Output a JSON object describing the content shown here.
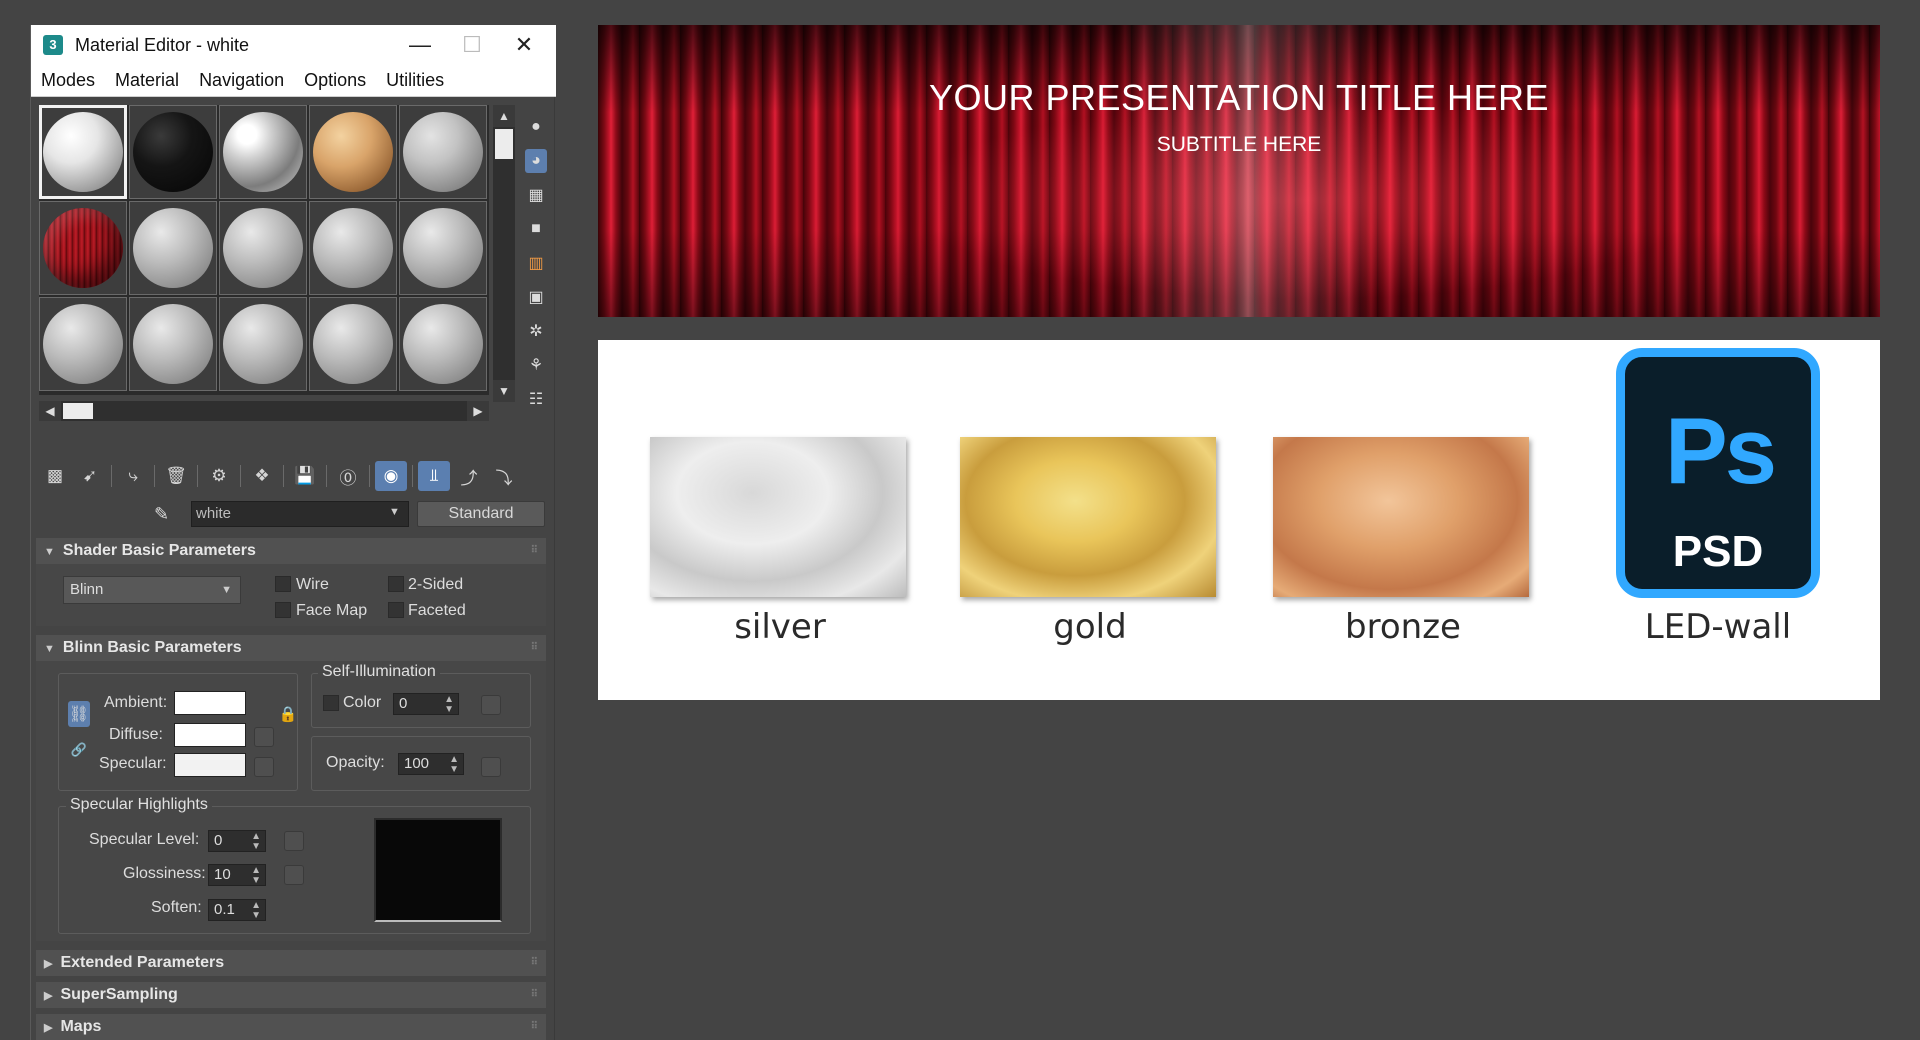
{
  "window": {
    "app_icon": "3",
    "title": "Material Editor - white",
    "minimize_icon": "minimize-icon",
    "maximize_icon": "maximize-icon",
    "close_icon": "close-icon"
  },
  "menu": [
    "Modes",
    "Material",
    "Navigation",
    "Options",
    "Utilities"
  ],
  "material": {
    "name": "white",
    "type": "Standard"
  },
  "shader_basic": {
    "header": "Shader Basic Parameters",
    "shader": "Blinn",
    "wire": "Wire",
    "two_sided": "2-Sided",
    "face_map": "Face Map",
    "faceted": "Faceted"
  },
  "blinn_basic": {
    "header": "Blinn Basic Parameters",
    "ambient": "Ambient:",
    "diffuse": "Diffuse:",
    "specular": "Specular:",
    "self_illum_title": "Self-Illumination",
    "color_label": "Color",
    "color_value": "0",
    "opacity_label": "Opacity:",
    "opacity_value": "100",
    "spec_highlights_title": "Specular Highlights",
    "spec_level_label": "Specular Level:",
    "spec_level_value": "0",
    "glossiness_label": "Glossiness:",
    "glossiness_value": "10",
    "soften_label": "Soften:",
    "soften_value": "0.1",
    "swatch_colors": {
      "ambient": "#ffffff",
      "diffuse": "#ffffff",
      "specular": "#f2f2f2"
    }
  },
  "rollouts": [
    "Extended Parameters",
    "SuperSampling",
    "Maps"
  ],
  "banner": {
    "title": "YOUR PRESENTATION TITLE HERE",
    "subtitle": "SUBTITLE HERE"
  },
  "textures": [
    {
      "label": "silver"
    },
    {
      "label": "gold"
    },
    {
      "label": "bronze"
    },
    {
      "label": "LED-wall",
      "icon_text": "Ps",
      "icon_caption": "PSD"
    }
  ],
  "colors": {
    "accent": "#5b7fb0",
    "ps_blue": "#31a8ff"
  }
}
